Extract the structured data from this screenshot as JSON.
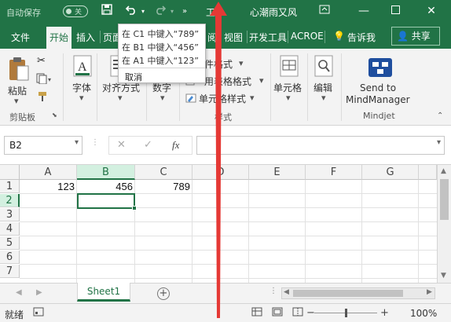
{
  "titlebar": {
    "autosave_label": "自动保存",
    "autosave_state": "关",
    "doc_title": "工...",
    "app_name": "心潮雨又风",
    "icons": [
      "save-icon",
      "undo-icon",
      "redo-icon",
      "customize-qat-icon"
    ]
  },
  "tabs": [
    "文件",
    "开始",
    "插入",
    "页面",
    "视图",
    "开发工具",
    "ACROE",
    "告诉我"
  ],
  "tab_extra": "阅",
  "share_label": "共享",
  "undo_dropdown": {
    "items": [
      "在 C1 中键入“789”",
      "在 B1 中键入“456”",
      "在 A1 中键入“123”"
    ],
    "cancel": "取消"
  },
  "ribbon": {
    "paste_label": "粘贴",
    "clipboard_group": "剪贴板",
    "font_label": "字体",
    "align_label": "对齐方式",
    "number_label": "数字",
    "cond_format": "件格式",
    "table_format": "用表格格式",
    "cell_style": "单元格样式",
    "styles_group": "样式",
    "cells_label": "单元格",
    "editing_label": "编辑",
    "mindjet_send": "Send to",
    "mindjet_app": "MindManager",
    "mindjet_group": "Mindjet"
  },
  "formula_bar": {
    "name_box": "B2",
    "fx": "fx",
    "value": ""
  },
  "grid": {
    "columns": [
      "A",
      "B",
      "C",
      "D",
      "E",
      "F",
      "G"
    ],
    "rows": [
      "1",
      "2",
      "3",
      "4",
      "5",
      "6",
      "7"
    ],
    "selected_col": "B",
    "selected_row": "2",
    "cells": {
      "A1": "123",
      "B1": "456",
      "C1": "789"
    }
  },
  "sheet_tabs": [
    "Sheet1"
  ],
  "status": {
    "ready": "就绪",
    "zoom": "100%"
  },
  "colors": {
    "brand": "#217346",
    "arrow": "#e53935"
  }
}
